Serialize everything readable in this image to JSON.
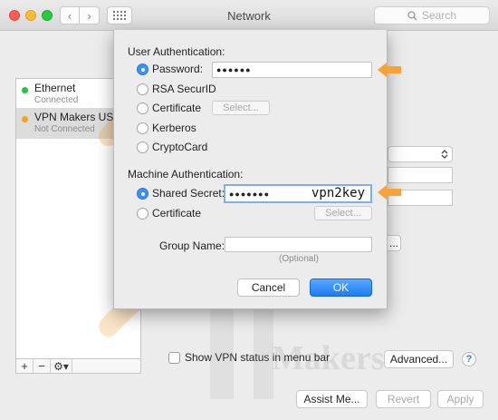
{
  "window": {
    "title": "Network"
  },
  "toolbar": {
    "search_placeholder": "Search"
  },
  "sidebar": {
    "services": [
      {
        "name": "Ethernet",
        "status": "Connected",
        "dot_color": "#27c23c"
      },
      {
        "name": "VPN Makers USA",
        "status": "Not Connected",
        "dot_color": "#f2a51a"
      }
    ],
    "tools": {
      "add": "+",
      "remove": "−",
      "gear": "⚙▾"
    }
  },
  "panel": {
    "show_vpn_status_label": "Show VPN status in menu bar",
    "advanced_label": "Advanced...",
    "help_label": "?",
    "partial_button_label": "..."
  },
  "footer": {
    "assist_label": "Assist Me...",
    "revert_label": "Revert",
    "apply_label": "Apply"
  },
  "sheet": {
    "user_auth": {
      "heading": "User Authentication:",
      "options": [
        {
          "label": "Password:",
          "selected": true
        },
        {
          "label": "RSA SecurID",
          "selected": false
        },
        {
          "label": "Certificate",
          "selected": false
        },
        {
          "label": "Kerberos",
          "selected": false
        },
        {
          "label": "CryptoCard",
          "selected": false
        }
      ],
      "password_value": "●●●●●●",
      "select_label": "Select..."
    },
    "machine_auth": {
      "heading": "Machine Authentication:",
      "options": [
        {
          "label": "Shared Secret:",
          "selected": true
        },
        {
          "label": "Certificate",
          "selected": false
        }
      ],
      "secret_dots": "●●●●●●●",
      "secret_text": "vpn2key",
      "select_label": "Select..."
    },
    "group_name": {
      "label": "Group Name:",
      "value": "",
      "hint": "(Optional)"
    },
    "cancel_label": "Cancel",
    "ok_label": "OK"
  },
  "colors": {
    "accent_arrow": "#f6a23a",
    "ok_blue": "#1c7cf4"
  },
  "watermark": {
    "text": "Makers"
  }
}
